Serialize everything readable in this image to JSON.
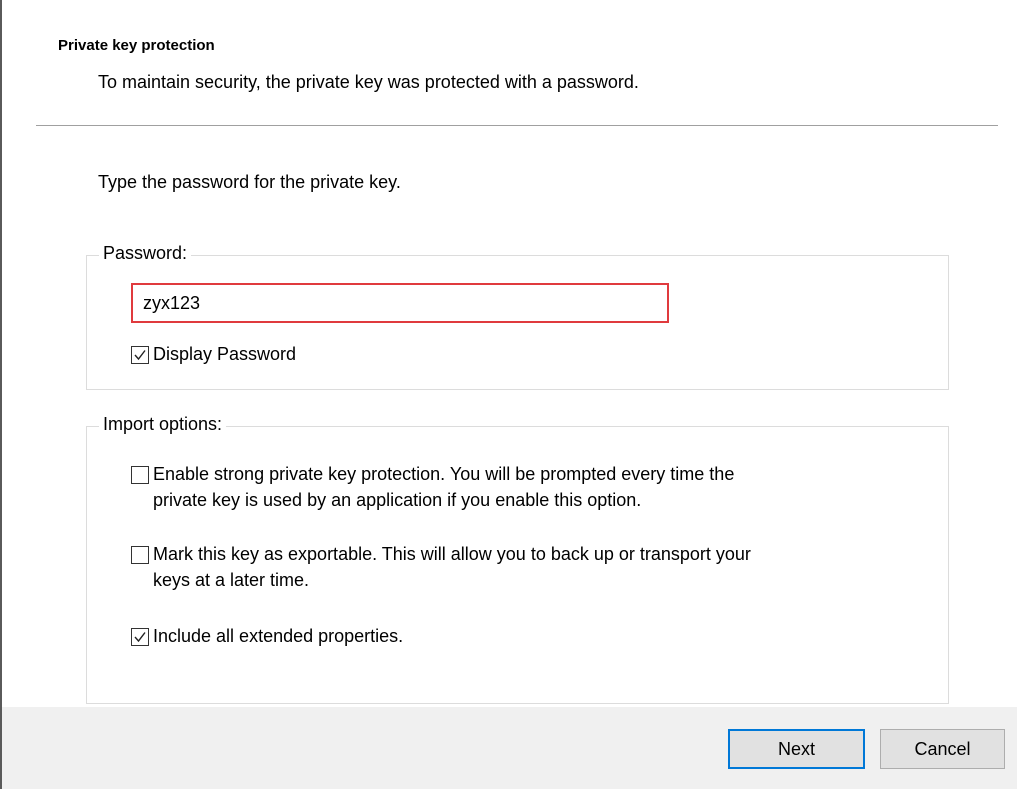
{
  "header": {
    "title": "Private key protection",
    "subtitle": "To maintain security, the private key was protected with a password."
  },
  "instruction": "Type the password for the private key.",
  "password_group": {
    "legend": "Password:",
    "password_value": "zyx123",
    "display_password": {
      "label": "Display Password",
      "checked": true
    }
  },
  "import_group": {
    "legend": "Import options:",
    "options": [
      {
        "line1": "Enable strong private key protection. You will be prompted every time the",
        "line2": "private key is used by an application if you enable this option.",
        "checked": false
      },
      {
        "line1": "Mark this key as exportable. This will allow you to back up or transport your",
        "line2": "keys at a later time.",
        "checked": false
      },
      {
        "line1": "Include all extended properties.",
        "line2": "",
        "checked": true
      }
    ]
  },
  "buttons": {
    "next": "Next",
    "cancel": "Cancel"
  },
  "colors": {
    "input_highlight_border": "#e03a3e",
    "default_button_border": "#0078d7",
    "footer_background": "#f0f0f0"
  }
}
